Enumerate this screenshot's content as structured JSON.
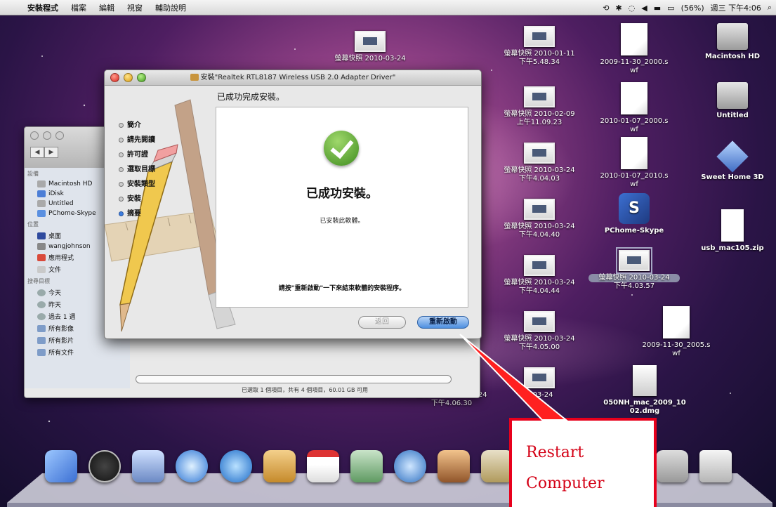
{
  "menubar": {
    "app": "安裝程式",
    "items": [
      "檔案",
      "編輯",
      "視窗",
      "輔助說明"
    ],
    "battery": "(56%)",
    "clock": "週三 下午4:06"
  },
  "desktop_items": [
    {
      "kind": "thumb",
      "line1": "螢幕快照 2010-03-24",
      "line2": ""
    },
    {
      "kind": "thumb",
      "line1": "螢幕快照 2010-01-11",
      "line2": "下午5.48.34"
    },
    {
      "kind": "doc",
      "line1": "2009-11-30_2000.s",
      "line2": "wf"
    },
    {
      "kind": "hd",
      "line1": "Macintosh HD",
      "line2": ""
    },
    {
      "kind": "thumb",
      "line1": "螢幕快照 2010-02-09",
      "line2": "上午11.09.23"
    },
    {
      "kind": "doc",
      "line1": "2010-01-07_2000.s",
      "line2": "wf"
    },
    {
      "kind": "hd",
      "line1": "Untitled",
      "line2": ""
    },
    {
      "kind": "thumb",
      "line1": "螢幕快照 2010-03-24",
      "line2": "下午4.04.03"
    },
    {
      "kind": "doc",
      "line1": "2010-01-07_2010.s",
      "line2": "wf"
    },
    {
      "kind": "cube",
      "line1": "Sweet Home 3D",
      "line2": ""
    },
    {
      "kind": "thumb",
      "line1": "螢幕快照 2010-03-24",
      "line2": "下午4.04.40"
    },
    {
      "kind": "app",
      "line1": "PChome-Skype",
      "line2": ""
    },
    {
      "kind": "zip",
      "line1": "usb_mac105.zip",
      "line2": ""
    },
    {
      "kind": "thumb",
      "line1": "螢幕快照 2010-03-24",
      "line2": "下午4.04.44"
    },
    {
      "kind": "thumb",
      "line1": "螢幕快照 2010-03-24",
      "line2": "下午4.03.57"
    },
    {
      "kind": "doc",
      "line1": "2009-11-30_2005.s",
      "line2": "wf"
    },
    {
      "kind": "thumb",
      "line1": "螢幕快照 2010-03-24",
      "line2": "下午4.05.00"
    },
    {
      "kind": "thumb",
      "line1": "螢幕快照 2010-03-24",
      "line2": "下午4.06.30"
    },
    {
      "kind": "thumb",
      "line1": "0-03-24",
      "line2": "6"
    },
    {
      "kind": "dmg",
      "line1": "050NH_mac_2009_10",
      "line2": "02.dmg"
    }
  ],
  "finder": {
    "sections": [
      {
        "header": "設備",
        "items": [
          "Macintosh HD",
          "iDisk",
          "Untitled",
          "PChome-Skype"
        ]
      },
      {
        "header": "位置",
        "items": [
          "桌面",
          "wangjohnson",
          "應用程式",
          "文件"
        ]
      },
      {
        "header": "搜尋目標",
        "items": [
          "今天",
          "昨天",
          "過去 1 週",
          "所有影像",
          "所有影片",
          "所有文件"
        ]
      }
    ],
    "status": "已選取 1 個項目，共有 4 個項目，60.01 GB 可用"
  },
  "installer": {
    "title": "安裝\"Realtek RTL8187 Wireless USB 2.0 Adapter Driver\"",
    "header": "已成功完成安裝。",
    "steps": [
      "簡介",
      "請先閱讀",
      "許可證",
      "選取目標",
      "安裝類型",
      "安裝",
      "摘要"
    ],
    "current_step": 6,
    "big_message": "已成功安裝。",
    "sub_message": "已安裝此軟體。",
    "note": "請按\"重新啟動\"一下來結束軟體的安裝程序。",
    "back_label": "返回",
    "restart_label": "重新啟動"
  },
  "callout": {
    "line1": "Restart",
    "line2": "Computer"
  }
}
